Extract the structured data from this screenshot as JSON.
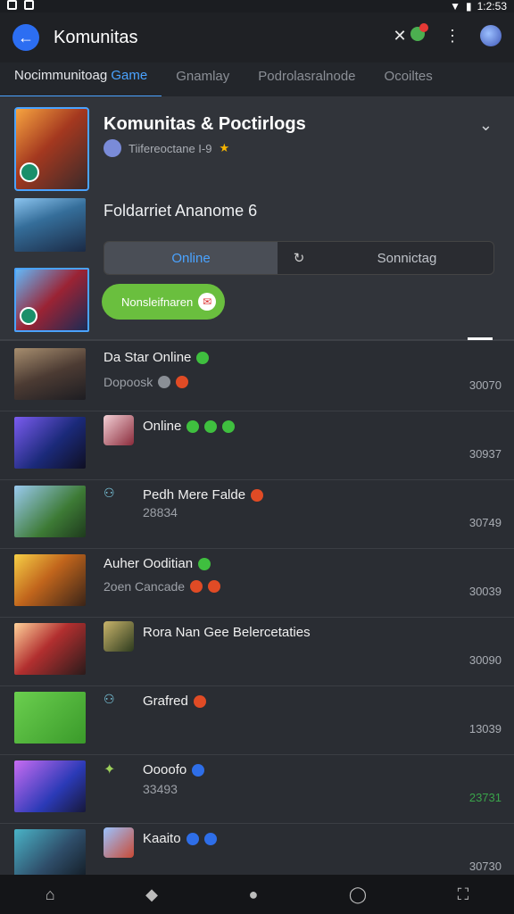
{
  "status": {
    "time": "1:2:53"
  },
  "appbar": {
    "title": "Komunitas"
  },
  "tabs": [
    {
      "prefix": "Nocimmunitoag",
      "accent": "Game"
    },
    {
      "label": "Gnamlay"
    },
    {
      "label": "Podrolasralnode"
    },
    {
      "label": "Ocoiltes"
    }
  ],
  "header": {
    "title": "Komunitas & Poctirlogs",
    "subtitle": "Tiifereoctane I-9",
    "section_label": "Foldarriet Ananome 6",
    "segments": {
      "left": "Online",
      "right": "Sonnictag"
    },
    "join_label": "Nonsleifnaren"
  },
  "rows": [
    {
      "title": "Da Star Online",
      "sub": "Dopoosk",
      "num": "30070",
      "num_color": "#a9adb4",
      "thumb": "linear-gradient(160deg,#a78e6f 0%, #4c3b33 50%, #1d1d22 100%)"
    },
    {
      "title": "Online",
      "sub": "",
      "num": "30937",
      "num_color": "#a9adb4",
      "thumb": "linear-gradient(135deg,#7b5cf0 0%, #1b2a7a 55%, #0f0f22 100%)"
    },
    {
      "title": "Pedh Mere Falde",
      "sub": "28834",
      "num": "30749",
      "num_color": "#a9adb4",
      "thumb": "linear-gradient(135deg,#9acaf0 0%, #3d7a35 60%, #1e3a1d 100%)"
    },
    {
      "title": "Auher Ooditian",
      "sub": "2oen Cancade",
      "num": "30039",
      "num_color": "#a9adb4",
      "thumb": "linear-gradient(135deg,#f6cf46 0%, #c1651c 45%, #3a2418 100%)"
    },
    {
      "title": "Rora Nan Gee Belercetaties",
      "sub": "",
      "num": "30090",
      "num_color": "#a9adb4",
      "thumb": "linear-gradient(135deg,#ffd29a 0%, #b22f2f 45%, #2a1b1b 100%)"
    },
    {
      "title": "Grafred",
      "sub": "",
      "num": "13039",
      "num_color": "#a9adb4",
      "thumb": "linear-gradient(135deg,#6bcf4f 0%, #3a9a2a 100%)"
    },
    {
      "title": "Oooofo",
      "sub": "33493",
      "num": "23731",
      "num_color": "#3aa34a",
      "thumb": "linear-gradient(135deg,#c86cf2 0%, #2b3ab7 60%, #17183a 100%)"
    },
    {
      "title": "Kaaito",
      "sub": "",
      "num": "30730",
      "num_color": "#a9adb4",
      "thumb": "linear-gradient(135deg,#4ab3c7 0%, #2f4e6a 55%, #121a22 100%)"
    }
  ]
}
